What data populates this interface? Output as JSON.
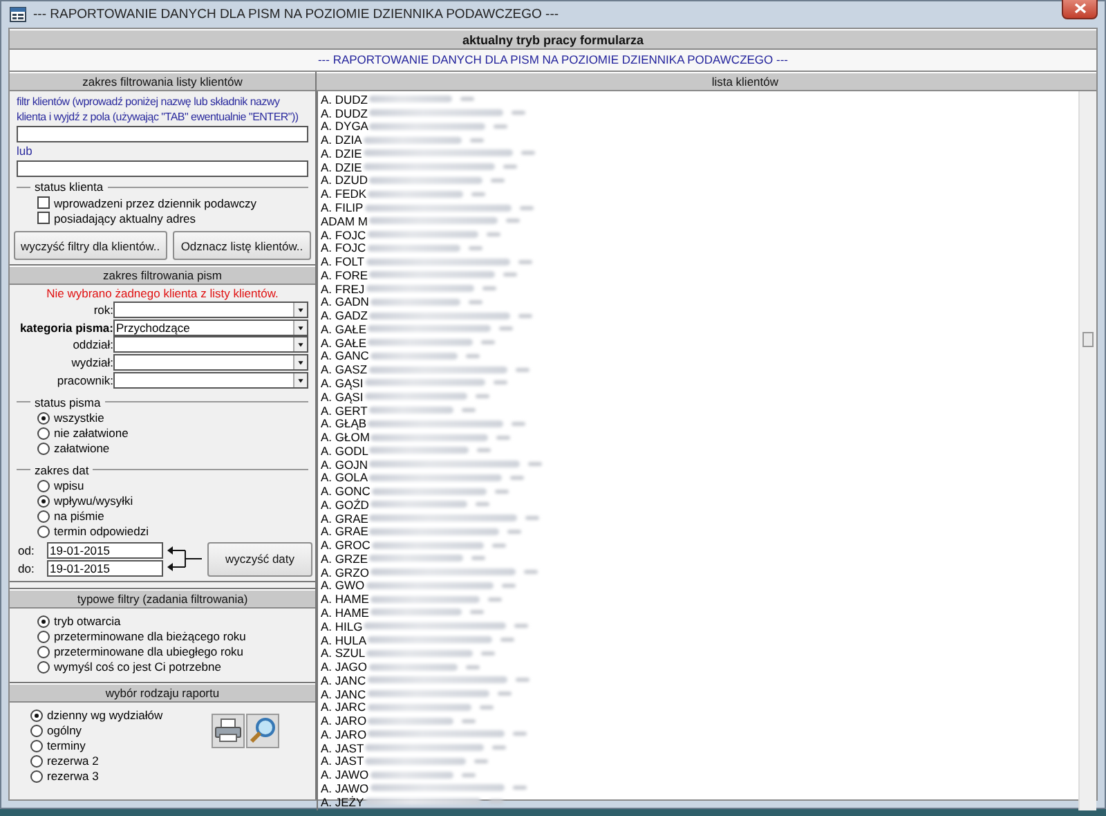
{
  "window": {
    "title": "--- RAPORTOWANIE DANYCH DLA PISM NA POZIOMIE DZIENNIKA PODAWCZEGO ---"
  },
  "mode_bar": {
    "heading": "aktualny tryb pracy formularza",
    "value": "--- RAPORTOWANIE DANYCH DLA PISM NA POZIOMIE DZIENNIKA PODAWCZEGO ---"
  },
  "client_filter": {
    "heading": "zakres filtrowania listy klientów",
    "hint": "filtr klientów (wprowadź poniżej nazwę lub składnik nazwy klienta i wyjdź z pola (używając \"TAB\" ewentualnie \"ENTER\"))",
    "or_label": "lub",
    "status_group": {
      "legend": "status klienta",
      "options": [
        {
          "label": "wprowadzeni przez dziennik podawczy",
          "checked": false
        },
        {
          "label": "posiadający aktualny adres",
          "checked": false
        }
      ]
    },
    "buttons": [
      "wyczyść filtry dla klientów..",
      "Odznacz listę klientów.."
    ]
  },
  "letter_filter": {
    "heading": "zakres filtrowania pism",
    "warning": "Nie wybrano żadnego klienta z listy klientów.",
    "fields": [
      {
        "label": "rok:",
        "emphasized": false
      },
      {
        "label": "kategoria pisma:",
        "value": "Przychodzące",
        "emphasized": true
      },
      {
        "label": "oddział:",
        "emphasized": false
      },
      {
        "label": "wydział:",
        "emphasized": false
      },
      {
        "label": "pracownik:",
        "emphasized": false
      }
    ],
    "groups": [
      {
        "legend": "status pisma",
        "options": [
          {
            "label": "wszystkie",
            "selected": true
          },
          {
            "label": "nie załatwione",
            "selected": false
          },
          {
            "label": "załatwione",
            "selected": false
          }
        ]
      },
      {
        "legend": "zakres dat",
        "options": [
          {
            "label": "wpisu",
            "selected": false
          },
          {
            "label": "wpływu/wysyłki",
            "selected": true
          },
          {
            "label": "na piśmie",
            "selected": false
          },
          {
            "label": "termin odpowiedzi",
            "selected": false
          }
        ]
      }
    ],
    "dates": [
      {
        "label": "od:",
        "value": "19-01-2015"
      },
      {
        "label": "do:",
        "value": "19-01-2015"
      }
    ],
    "clear_dates_button": "wyczyść daty"
  },
  "typical_filters": {
    "heading": "typowe filtry (zadania filtrowania)",
    "options": [
      {
        "label": "tryb otwarcia",
        "selected": true
      },
      {
        "label": "przeterminowane dla bieżącego roku",
        "selected": false
      },
      {
        "label": "przeterminowane dla ubiegłego roku",
        "selected": false
      },
      {
        "label": "wymyśl coś co jest Ci potrzebne",
        "selected": false
      }
    ]
  },
  "report_type": {
    "heading": "wybór rodzaju raportu",
    "options": [
      {
        "label": "dzienny wg wydziałów",
        "selected": true
      },
      {
        "label": "ogólny",
        "selected": false
      },
      {
        "label": "terminy",
        "selected": false
      },
      {
        "label": "rezerwa 2",
        "selected": false
      },
      {
        "label": "rezerwa 3",
        "selected": false
      }
    ]
  },
  "client_list": {
    "heading": "lista klientów",
    "items": [
      "A. DUDZ",
      "A. DUDZ",
      "A. DYGA",
      "A. DZIA",
      "A. DZIE",
      "A. DZIE",
      "A. DZUD",
      "A. FEDK",
      "A. FILIP",
      "ADAM M",
      "A. FOJC",
      "A. FOJC",
      "A. FOLT",
      "A. FORE",
      "A. FREJ",
      "A. GADN",
      "A. GADZ",
      "A. GAŁE",
      "A. GAŁE",
      "A. GANC",
      "A. GASZ",
      "A. GĄSI",
      "A. GĄSI",
      "A. GERT",
      "A. GŁĄB",
      "A. GŁOM",
      "A. GODL",
      "A. GOJN",
      "A. GOLA",
      "A. GONC",
      "A. GOŹD",
      "A. GRAE",
      "A. GRAE",
      "A. GROC",
      "A. GRZE",
      "A. GRZO",
      "A. GWO",
      "A. HAME",
      "A. HAME",
      "A. HILG",
      "A. HULA",
      "A. SZUL",
      "A. JAGO",
      "A. JANC",
      "A. JANC",
      "A. JARC",
      "A. JARO",
      "A. JARO",
      "A. JAST",
      "A. JAST",
      "A. JAWO",
      "A. JAWO",
      "A. JEŻY"
    ]
  }
}
